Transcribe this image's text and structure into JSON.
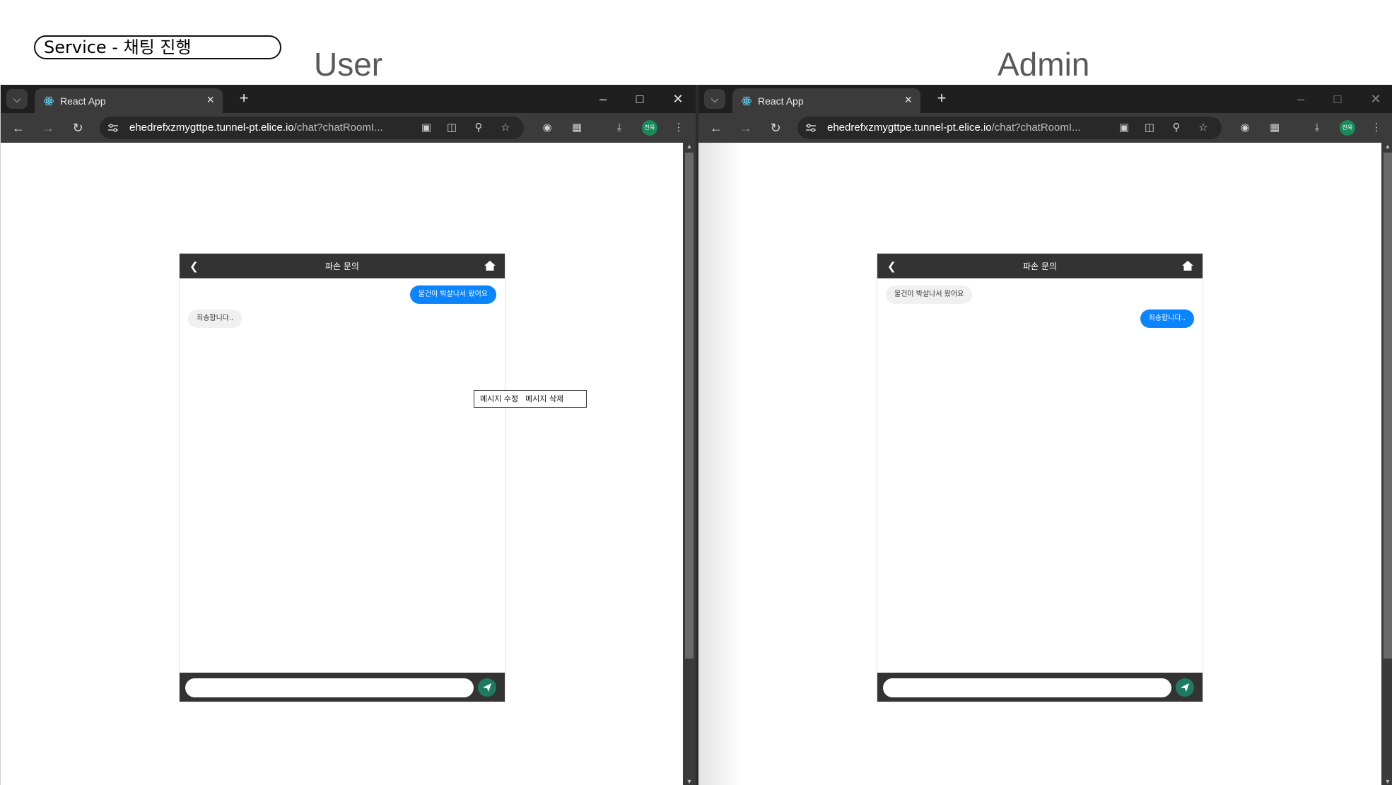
{
  "service_label": "Service - 채팅 진행",
  "panels": [
    {
      "heading": "User",
      "tab": {
        "title": "React App"
      },
      "url": {
        "host": "ehedrefxzmygttpe.tunnel-pt.elice.io",
        "path": "/chat?chatRoomI..."
      },
      "profile_label": "진욱",
      "chat": {
        "title": "파손 문의",
        "messages": [
          {
            "text": "물건이 박살나서 왔어요",
            "sender": "mine"
          },
          {
            "text": "죄송합니다..",
            "sender": "theirs"
          }
        ],
        "context_menu": {
          "edit": "메시지 수정",
          "delete": "메시지 삭제"
        },
        "input": {
          "value": "",
          "placeholder": ""
        }
      }
    },
    {
      "heading": "Admin",
      "tab": {
        "title": "React App"
      },
      "url": {
        "host": "ehedrefxzmygttpe.tunnel-pt.elice.io",
        "path": "/chat?chatRoomI..."
      },
      "profile_label": "진욱",
      "chat": {
        "title": "파손 문의",
        "messages": [
          {
            "text": "물건이 박살나서 왔어요",
            "sender": "theirs"
          },
          {
            "text": "죄송합니다..",
            "sender": "mine"
          }
        ],
        "input": {
          "value": "",
          "placeholder": ""
        }
      }
    }
  ],
  "colors": {
    "my_bubble": "#0a84ff",
    "their_bubble": "#f0f0f0",
    "chat_bar": "#333333",
    "send_button": "#1f7a62"
  }
}
